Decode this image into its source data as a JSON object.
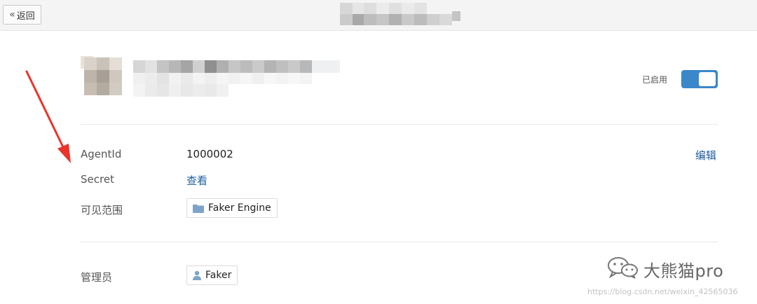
{
  "topbar": {
    "back_label": "返回",
    "back_icon": "double-chevron-left-icon"
  },
  "app": {
    "toggle_label": "已启用",
    "toggle_on": true,
    "accent_color": "#3a87c9"
  },
  "details": {
    "agentid_label": "AgentId",
    "agentid_value": "1000002",
    "edit_label": "编辑",
    "secret_label": "Secret",
    "secret_value": "查看",
    "scope_label": "可见范围",
    "scope_value": "Faker Engine",
    "scope_icon": "folder-icon"
  },
  "admin": {
    "label": "管理员",
    "value": "Faker",
    "icon": "person-icon"
  },
  "watermark": {
    "text": "大熊猫pro",
    "url": "https://blog.csdn.net/weixin_42565036",
    "icon": "wechat-icon"
  }
}
